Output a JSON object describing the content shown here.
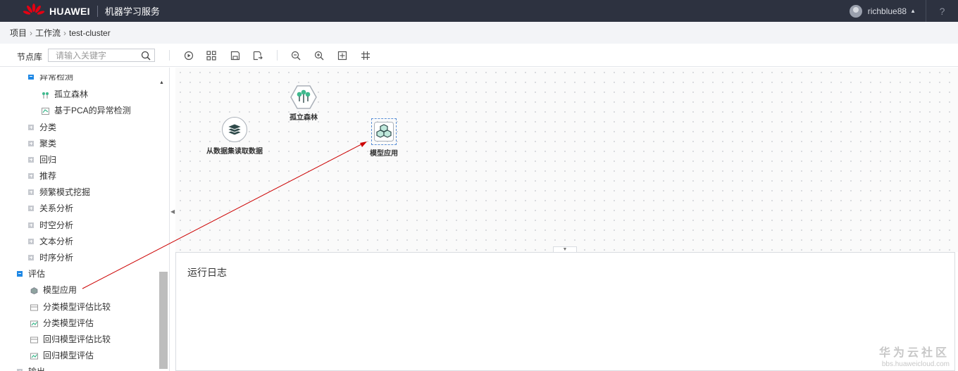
{
  "topbar": {
    "brand": "HUAWEI",
    "service": "机器学习服务",
    "user": "richblue88",
    "help": "?"
  },
  "breadcrumb": [
    "项目",
    "工作流",
    "test-cluster"
  ],
  "toolbar": {
    "library_label": "节点库",
    "search_placeholder": "请输入关键字",
    "buttons": [
      "run",
      "layout",
      "save",
      "save-as",
      "zoom-out",
      "zoom-in",
      "fit",
      "grid"
    ]
  },
  "tree": {
    "anomaly_group": "异常检测",
    "isolation_forest": "孤立森林",
    "pca_anomaly": "基于PCA的异常检测",
    "classification": "分类",
    "clustering": "聚类",
    "regression": "回归",
    "recommendation": "推荐",
    "frequent_pattern": "频繁模式挖掘",
    "relation": "关系分析",
    "spatiotemporal": "时空分析",
    "text": "文本分析",
    "timeseries": "时序分析",
    "evaluation": "评估",
    "eval_items": [
      "模型应用",
      "分类模型评估比较",
      "分类模型评估",
      "回归模型评估比较",
      "回归模型评估"
    ],
    "output": "输出"
  },
  "canvas": {
    "nodes": {
      "dataset": "从数据集读取数据",
      "forest": "孤立森林",
      "apply": "模型应用"
    }
  },
  "log": {
    "title": "运行日志"
  },
  "watermark": {
    "name": "华为云社区",
    "url": "bbs.huaweicloud.com"
  },
  "colors": {
    "topbar": "#2d3240",
    "accent": "#1e88e5",
    "annotation_arrow": "#cc0000",
    "node_green": "#3fb98e"
  }
}
